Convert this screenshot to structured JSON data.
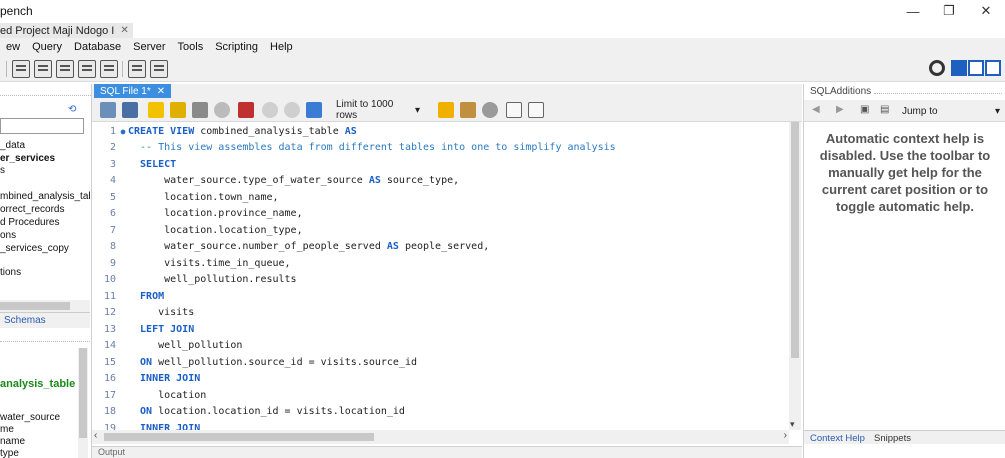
{
  "window": {
    "title": "pench",
    "minimize": "—",
    "restore": "❐",
    "close": "✕"
  },
  "connection_tab": {
    "label": "ed Project Maji Ndogo I",
    "close": "✕"
  },
  "menu": [
    "ew",
    "Query",
    "Database",
    "Server",
    "Tools",
    "Scripting",
    "Help"
  ],
  "sidebar": {
    "items": [
      {
        "label": "_data",
        "style": "normal"
      },
      {
        "label": "er_services",
        "style": "bold"
      },
      {
        "label": "s",
        "style": "normal"
      },
      {
        "label": "mbined_analysis_table",
        "style": "normal"
      },
      {
        "label": "orrect_records",
        "style": "normal"
      },
      {
        "label": "d Procedures",
        "style": "normal"
      },
      {
        "label": "ons",
        "style": "normal"
      },
      {
        "label": "_services_copy",
        "style": "normal"
      },
      {
        "label": "tions",
        "style": "normal"
      }
    ],
    "tab_schemas": "Schemas",
    "info_items": [
      {
        "label": "analysis_table",
        "style": "green"
      },
      {
        "label": "water_source",
        "style": "normal"
      },
      {
        "label": "me",
        "style": "normal"
      },
      {
        "label": "name",
        "style": "normal"
      },
      {
        "label": "type",
        "style": "normal"
      }
    ]
  },
  "editor": {
    "tab_label": "SQL File 1*",
    "tab_close": "✕",
    "limit_label": "Limit to 1000 rows",
    "lines": [
      {
        "n": "1",
        "dot": true,
        "parts": [
          [
            "kw",
            "CREATE VIEW "
          ],
          [
            "t",
            "combined_analysis_table "
          ],
          [
            "kw",
            "AS"
          ]
        ]
      },
      {
        "n": "2",
        "parts": [
          [
            "cmt",
            "  -- This view assembles data from different tables into one to simplify analysis"
          ]
        ]
      },
      {
        "n": "3",
        "parts": [
          [
            "kw",
            "  SELECT"
          ]
        ]
      },
      {
        "n": "4",
        "parts": [
          [
            "t",
            "      water_source.type_of_water_source "
          ],
          [
            "kw",
            "AS "
          ],
          [
            "t",
            "source_type,"
          ]
        ]
      },
      {
        "n": "5",
        "parts": [
          [
            "t",
            "      location.town_name,"
          ]
        ]
      },
      {
        "n": "6",
        "parts": [
          [
            "t",
            "      location.province_name,"
          ]
        ]
      },
      {
        "n": "7",
        "parts": [
          [
            "t",
            "      location.location_type,"
          ]
        ]
      },
      {
        "n": "8",
        "parts": [
          [
            "t",
            "      water_source.number_of_people_served "
          ],
          [
            "kw",
            "AS "
          ],
          [
            "t",
            "people_served,"
          ]
        ]
      },
      {
        "n": "9",
        "parts": [
          [
            "t",
            "      visits.time_in_queue,"
          ]
        ]
      },
      {
        "n": "10",
        "parts": [
          [
            "t",
            "      well_pollution.results"
          ]
        ]
      },
      {
        "n": "11",
        "parts": [
          [
            "kw",
            "  FROM"
          ]
        ]
      },
      {
        "n": "12",
        "parts": [
          [
            "t",
            "     visits"
          ]
        ]
      },
      {
        "n": "13",
        "parts": [
          [
            "kw",
            "  LEFT JOIN"
          ]
        ]
      },
      {
        "n": "14",
        "parts": [
          [
            "t",
            "     well_pollution"
          ]
        ]
      },
      {
        "n": "15",
        "parts": [
          [
            "kw",
            "  ON "
          ],
          [
            "t",
            "well_pollution.source_id = visits.source_id"
          ]
        ]
      },
      {
        "n": "16",
        "parts": [
          [
            "kw",
            "  INNER JOIN"
          ]
        ]
      },
      {
        "n": "17",
        "parts": [
          [
            "t",
            "     location"
          ]
        ]
      },
      {
        "n": "18",
        "parts": [
          [
            "kw",
            "  ON "
          ],
          [
            "t",
            "location.location_id = visits.location_id"
          ]
        ]
      },
      {
        "n": "19",
        "parts": [
          [
            "kw",
            "  INNER JOIN"
          ]
        ]
      }
    ]
  },
  "output_label": "Output",
  "sql_additions": {
    "title": "SQLAdditions",
    "jump_label": "Jump to",
    "help_text": "Automatic context help is disabled. Use the toolbar to manually get help for the current caret position or to toggle automatic help.",
    "tab_context_help": "Context Help",
    "tab_snippets": "Snippets"
  }
}
